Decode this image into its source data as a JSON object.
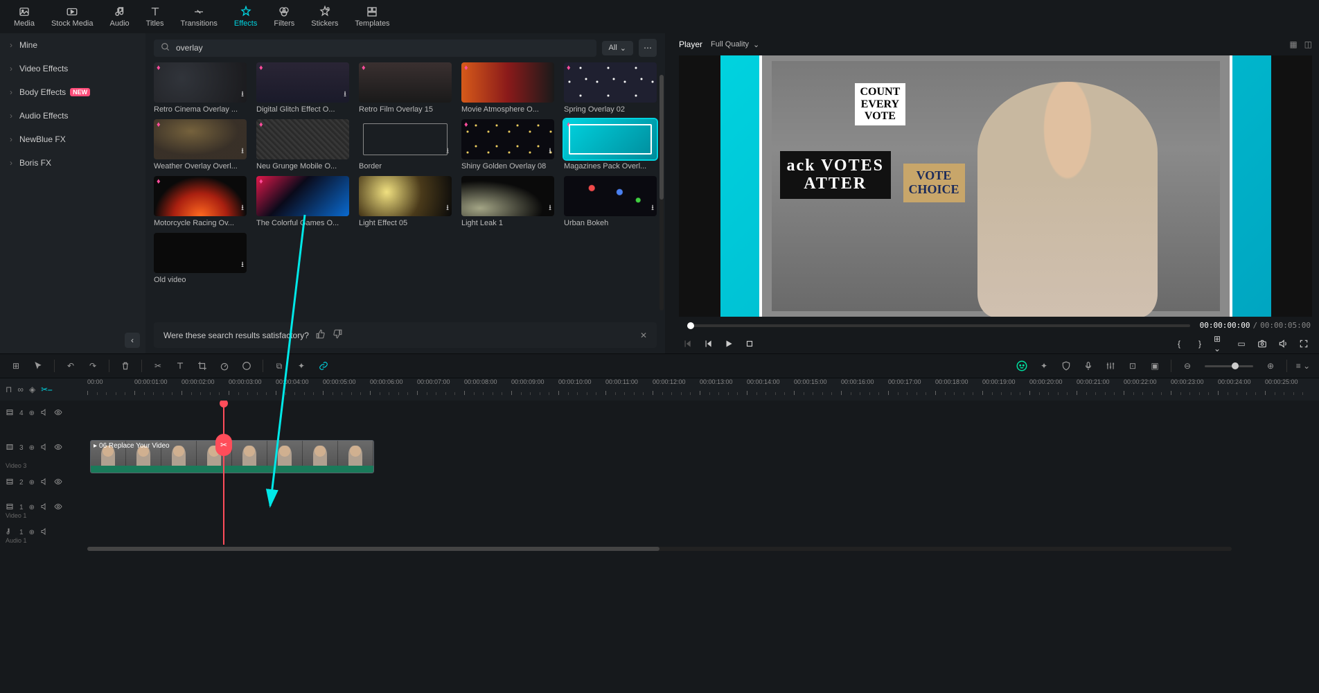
{
  "tabs": [
    {
      "id": "media",
      "label": "Media"
    },
    {
      "id": "stock",
      "label": "Stock Media"
    },
    {
      "id": "audio",
      "label": "Audio"
    },
    {
      "id": "titles",
      "label": "Titles"
    },
    {
      "id": "transitions",
      "label": "Transitions"
    },
    {
      "id": "effects",
      "label": "Effects",
      "active": true
    },
    {
      "id": "filters",
      "label": "Filters"
    },
    {
      "id": "stickers",
      "label": "Stickers"
    },
    {
      "id": "templates",
      "label": "Templates"
    }
  ],
  "sidebar": {
    "items": [
      {
        "label": "Mine"
      },
      {
        "label": "Video Effects"
      },
      {
        "label": "Body Effects",
        "badge": "NEW"
      },
      {
        "label": "Audio Effects"
      },
      {
        "label": "NewBlue FX"
      },
      {
        "label": "Boris FX"
      }
    ]
  },
  "search": {
    "value": "overlay",
    "filter": "All"
  },
  "effects": [
    {
      "label": "Retro Cinema Overlay ...",
      "cls": "t-retro",
      "dl": true
    },
    {
      "label": "Digital Glitch Effect O...",
      "cls": "t-glitch",
      "dl": true
    },
    {
      "label": "Retro Film Overlay 15",
      "cls": "t-film"
    },
    {
      "label": "Movie Atmosphere O...",
      "cls": "t-movie"
    },
    {
      "label": "Spring Overlay 02",
      "cls": "t-spring"
    },
    {
      "label": "Weather Overlay Overl...",
      "cls": "t-weather",
      "dl": true
    },
    {
      "label": "Neu Grunge Mobile O...",
      "cls": "t-grunge"
    },
    {
      "label": "Border",
      "cls": "t-border",
      "nogem": true,
      "dl": true
    },
    {
      "label": "Shiny Golden Overlay 08",
      "cls": "t-shiny",
      "dl": true
    },
    {
      "label": "Magazines Pack Overl...",
      "cls": "t-mag",
      "selected": true
    },
    {
      "label": "Motorcycle Racing Ov...",
      "cls": "t-moto",
      "dl": true
    },
    {
      "label": "The Colorful Games O...",
      "cls": "t-games"
    },
    {
      "label": "Light Effect 05",
      "cls": "t-light",
      "nogem": true,
      "dl": true
    },
    {
      "label": "Light Leak 1",
      "cls": "t-leak",
      "nogem": true,
      "dl": true
    },
    {
      "label": "Urban Bokeh",
      "cls": "t-bokeh",
      "nogem": true,
      "dl": true
    },
    {
      "label": "Old video",
      "cls": "t-old",
      "nogem": true,
      "dl": true
    }
  ],
  "feedback": {
    "text": "Were these search results satisfactory?"
  },
  "player": {
    "label": "Player",
    "quality": "Full Quality",
    "current": "00:00:00:00",
    "sep": "/",
    "total": "00:00:05:00",
    "signs": {
      "s1": "COUNT\nEVERY\nVOTE",
      "s2": "ack VOTES\nATTER",
      "s3": "VOTE\nCHOICE"
    }
  },
  "timeline": {
    "ticks": [
      "00:00",
      "00:00:01:00",
      "00:00:02:00",
      "00:00:03:00",
      "00:00:04:00",
      "00:00:05:00",
      "00:00:06:00",
      "00:00:07:00",
      "00:00:08:00",
      "00:00:09:00",
      "00:00:10:00",
      "00:00:11:00",
      "00:00:12:00",
      "00:00:13:00",
      "00:00:14:00",
      "00:00:15:00",
      "00:00:16:00",
      "00:00:17:00",
      "00:00:18:00",
      "00:00:19:00",
      "00:00:20:00",
      "00:00:21:00",
      "00:00:22:00",
      "00:00:23:00",
      "00:00:24:00",
      "00:00:25:00"
    ],
    "tracks": [
      {
        "icon": "film",
        "label": "4",
        "sub": ""
      },
      {
        "icon": "film",
        "label": "3",
        "sub": "Video 3"
      },
      {
        "icon": "film",
        "label": "2",
        "sub": ""
      },
      {
        "icon": "film",
        "label": "1",
        "sub": "Video 1"
      },
      {
        "icon": "audio",
        "label": "1",
        "sub": "Audio 1"
      }
    ],
    "clip": {
      "name": "06 Replace Your Video"
    }
  }
}
